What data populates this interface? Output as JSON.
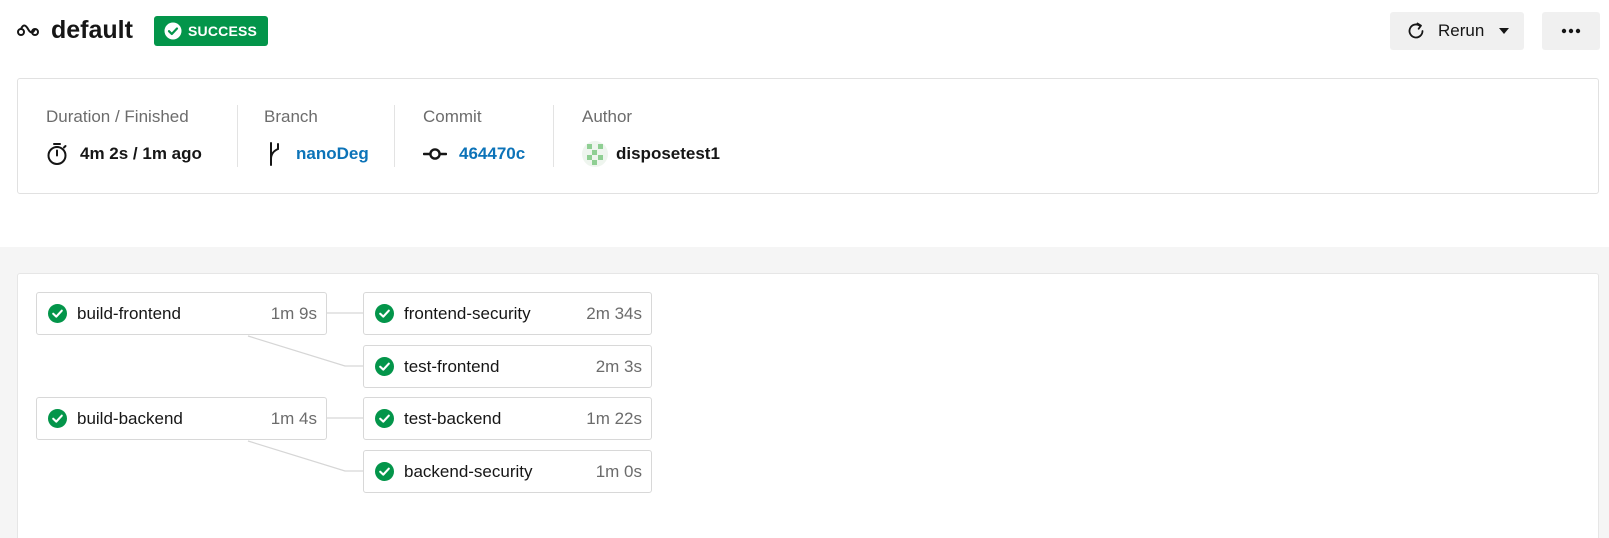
{
  "header": {
    "title": "default",
    "status": "SUCCESS",
    "rerun_label": "Rerun"
  },
  "meta": {
    "duration_label": "Duration / Finished",
    "duration_value": "4m 2s / 1m ago",
    "branch_label": "Branch",
    "branch_value": "nanoDeg",
    "commit_label": "Commit",
    "commit_value": "464470c",
    "author_label": "Author",
    "author_value": "disposetest1"
  },
  "jobs": [
    {
      "name": "build-frontend",
      "duration": "1m 9s",
      "status": "success"
    },
    {
      "name": "frontend-security",
      "duration": "2m 34s",
      "status": "success"
    },
    {
      "name": "test-frontend",
      "duration": "2m 3s",
      "status": "success"
    },
    {
      "name": "build-backend",
      "duration": "1m 4s",
      "status": "success"
    },
    {
      "name": "test-backend",
      "duration": "1m 22s",
      "status": "success"
    },
    {
      "name": "backend-security",
      "duration": "1m 0s",
      "status": "success"
    }
  ],
  "colors": {
    "success": "#03954a",
    "link": "#0c73b8",
    "muted": "#6c6c6c"
  },
  "icons": {
    "workflow": "workflow-icon",
    "status": "check-circle-icon",
    "rerun": "refresh-icon",
    "more": "ellipsis-icon",
    "duration": "timer-icon",
    "branch": "git-branch-icon",
    "commit": "git-commit-icon",
    "author": "avatar"
  }
}
